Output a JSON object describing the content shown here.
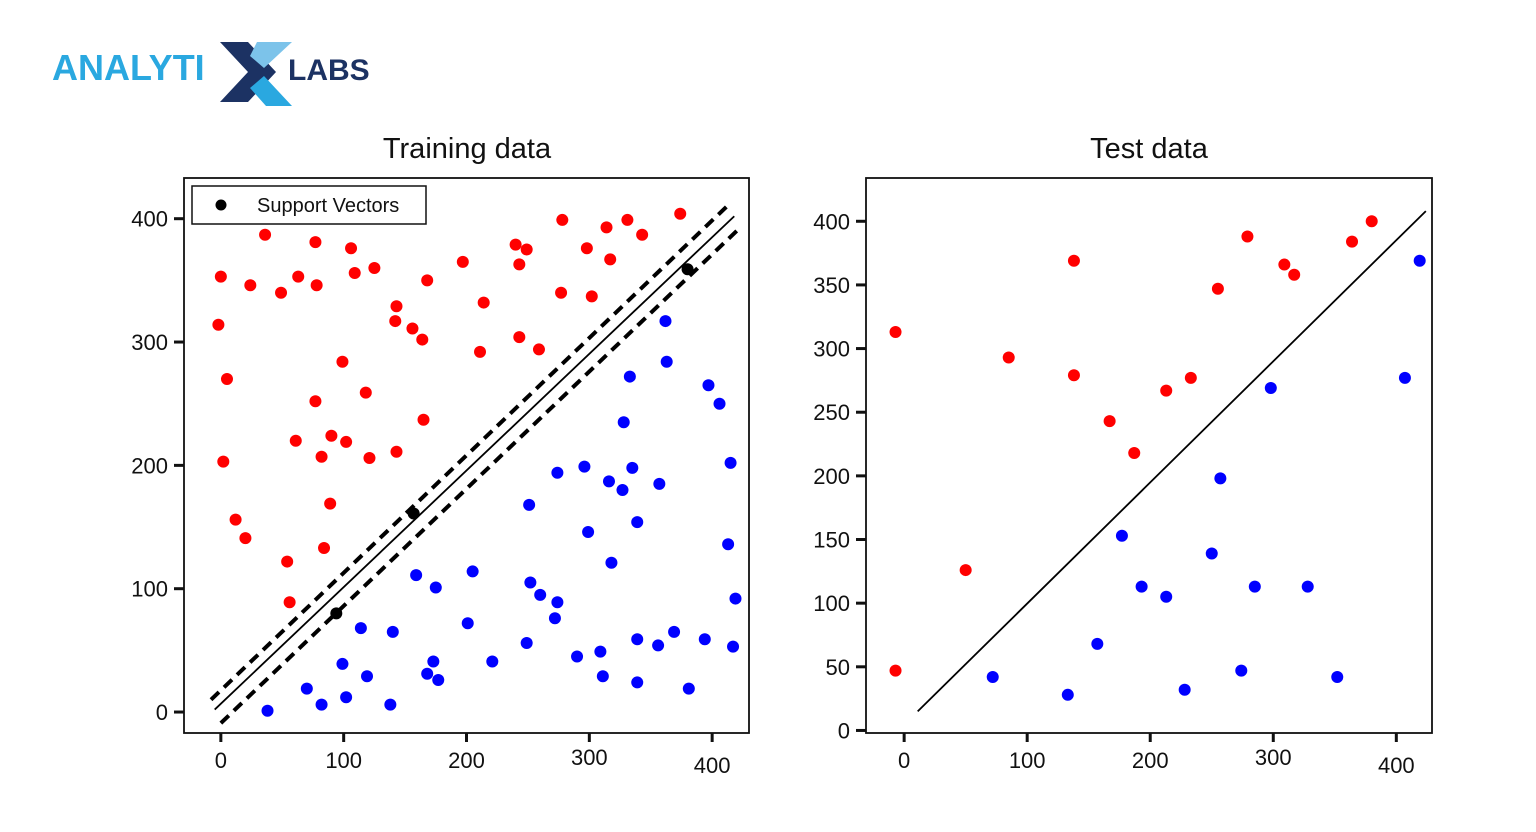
{
  "logo": {
    "text_left": "ANALYTI",
    "text_x": "X",
    "text_right": "LABS",
    "color_light": "#2aa8e0",
    "color_dark": "#1c3263"
  },
  "colors": {
    "class_a": "#ff0000",
    "class_b": "#0000ff",
    "support": "#000000"
  },
  "chart_data": [
    {
      "type": "scatter",
      "title": "Training data",
      "xlabel": "",
      "ylabel": "",
      "xlim": [
        -30,
        430
      ],
      "ylim": [
        -17,
        433
      ],
      "xticks": [
        0,
        100,
        200,
        300,
        400
      ],
      "yticks": [
        0,
        100,
        200,
        300,
        400
      ],
      "grid": false,
      "legend": {
        "placement": "top-left",
        "entries": [
          {
            "label": "Support Vectors",
            "marker": "black-dot"
          }
        ]
      },
      "series": [
        {
          "name": "Class red",
          "color": "#ff0000",
          "points": [
            [
              0,
              353
            ],
            [
              -2,
              314
            ],
            [
              5,
              270
            ],
            [
              2,
              203
            ],
            [
              12,
              156
            ],
            [
              20,
              141
            ],
            [
              24,
              346
            ],
            [
              36,
              387
            ],
            [
              49,
              340
            ],
            [
              63,
              353
            ],
            [
              77,
              381
            ],
            [
              78,
              346
            ],
            [
              106,
              376
            ],
            [
              109,
              356
            ],
            [
              125,
              360
            ],
            [
              143,
              329
            ],
            [
              142,
              317
            ],
            [
              156,
              311
            ],
            [
              164,
              302
            ],
            [
              168,
              350
            ],
            [
              99,
              284
            ],
            [
              61,
              220
            ],
            [
              77,
              252
            ],
            [
              90,
              224
            ],
            [
              82,
              207
            ],
            [
              102,
              219
            ],
            [
              118,
              259
            ],
            [
              121,
              206
            ],
            [
              143,
              211
            ],
            [
              165,
              237
            ],
            [
              89,
              169
            ],
            [
              84,
              133
            ],
            [
              54,
              122
            ],
            [
              56,
              89
            ],
            [
              197,
              365
            ],
            [
              214,
              332
            ],
            [
              211,
              292
            ],
            [
              240,
              379
            ],
            [
              243,
              363
            ],
            [
              249,
              375
            ],
            [
              243,
              304
            ],
            [
              259,
              294
            ],
            [
              278,
              399
            ],
            [
              277,
              340
            ],
            [
              298,
              376
            ],
            [
              302,
              337
            ],
            [
              314,
              393
            ],
            [
              317,
              367
            ],
            [
              331,
              399
            ],
            [
              343,
              387
            ],
            [
              374,
              404
            ]
          ]
        },
        {
          "name": "Class blue",
          "color": "#0000ff",
          "points": [
            [
              38,
              1
            ],
            [
              70,
              19
            ],
            [
              82,
              6
            ],
            [
              99,
              39
            ],
            [
              102,
              12
            ],
            [
              114,
              68
            ],
            [
              119,
              29
            ],
            [
              138,
              6
            ],
            [
              140,
              65
            ],
            [
              159,
              111
            ],
            [
              168,
              31
            ],
            [
              173,
              41
            ],
            [
              177,
              26
            ],
            [
              175,
              101
            ],
            [
              201,
              72
            ],
            [
              205,
              114
            ],
            [
              221,
              41
            ],
            [
              249,
              56
            ],
            [
              252,
              105
            ],
            [
              260,
              95
            ],
            [
              274,
              89
            ],
            [
              272,
              76
            ],
            [
              251,
              168
            ],
            [
              274,
              194
            ],
            [
              290,
              45
            ],
            [
              296,
              199
            ],
            [
              299,
              146
            ],
            [
              309,
              49
            ],
            [
              311,
              29
            ],
            [
              316,
              187
            ],
            [
              318,
              121
            ],
            [
              327,
              180
            ],
            [
              328,
              235
            ],
            [
              333,
              272
            ],
            [
              335,
              198
            ],
            [
              339,
              154
            ],
            [
              339,
              59
            ],
            [
              339,
              24
            ],
            [
              356,
              54
            ],
            [
              357,
              185
            ],
            [
              362,
              317
            ],
            [
              363,
              284
            ],
            [
              369,
              65
            ],
            [
              381,
              19
            ],
            [
              394,
              59
            ],
            [
              397,
              265
            ],
            [
              406,
              250
            ],
            [
              415,
              202
            ],
            [
              413,
              136
            ],
            [
              419,
              92
            ],
            [
              417,
              53
            ]
          ]
        },
        {
          "name": "Support Vectors",
          "color": "#000000",
          "points": [
            [
              94,
              80
            ],
            [
              157,
              161
            ],
            [
              380,
              359
            ]
          ]
        }
      ],
      "lines": [
        {
          "name": "decision-boundary",
          "style": "solid",
          "from": [
            -5,
            2
          ],
          "to": [
            418,
            402
          ]
        },
        {
          "name": "margin-upper",
          "style": "dashed",
          "from": [
            -8,
            10
          ],
          "to": [
            412,
            410
          ]
        },
        {
          "name": "margin-lower",
          "style": "dashed",
          "from": [
            0,
            -9
          ],
          "to": [
            422,
            392
          ]
        }
      ]
    },
    {
      "type": "scatter",
      "title": "Test data",
      "xlabel": "",
      "ylabel": "",
      "xlim": [
        -31,
        429
      ],
      "ylim": [
        -2,
        434
      ],
      "xticks": [
        0,
        100,
        200,
        300,
        400
      ],
      "yticks": [
        0,
        50,
        100,
        150,
        200,
        250,
        300,
        350,
        400
      ],
      "grid": false,
      "series": [
        {
          "name": "Class red",
          "color": "#ff0000",
          "points": [
            [
              -7,
              313
            ],
            [
              -7,
              47
            ],
            [
              50,
              126
            ],
            [
              85,
              293
            ],
            [
              138,
              369
            ],
            [
              138,
              279
            ],
            [
              167,
              243
            ],
            [
              187,
              218
            ],
            [
              213,
              267
            ],
            [
              233,
              277
            ],
            [
              255,
              347
            ],
            [
              279,
              388
            ],
            [
              309,
              366
            ],
            [
              317,
              358
            ],
            [
              364,
              384
            ],
            [
              380,
              400
            ]
          ]
        },
        {
          "name": "Class blue",
          "color": "#0000ff",
          "points": [
            [
              72,
              42
            ],
            [
              133,
              28
            ],
            [
              157,
              68
            ],
            [
              177,
              153
            ],
            [
              193,
              113
            ],
            [
              213,
              105
            ],
            [
              228,
              32
            ],
            [
              250,
              139
            ],
            [
              257,
              198
            ],
            [
              274,
              47
            ],
            [
              285,
              113
            ],
            [
              298,
              269
            ],
            [
              328,
              113
            ],
            [
              352,
              42
            ],
            [
              407,
              277
            ],
            [
              419,
              369
            ]
          ]
        }
      ],
      "lines": [
        {
          "name": "decision-boundary",
          "style": "solid",
          "from": [
            11,
            15
          ],
          "to": [
            424,
            408
          ]
        }
      ]
    }
  ]
}
